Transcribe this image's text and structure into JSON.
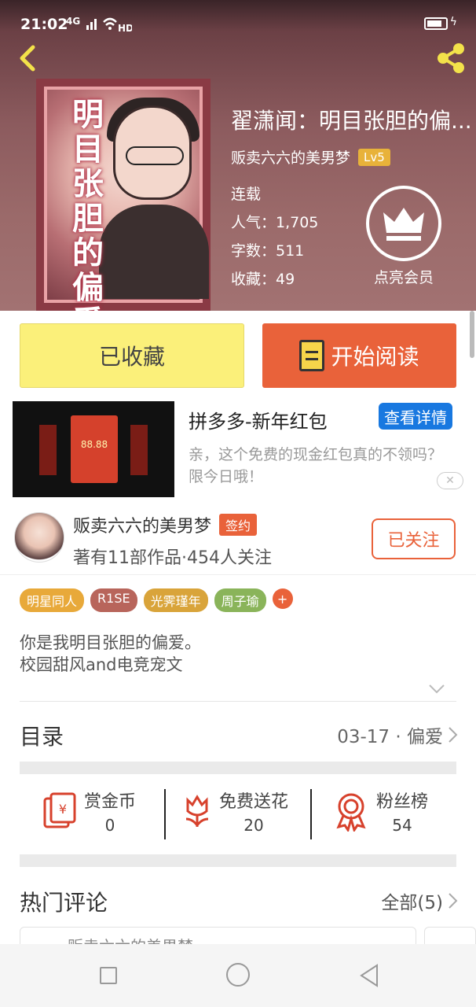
{
  "status_bar": {
    "time": "21:02",
    "network": "4G"
  },
  "book": {
    "title": "翟潇闻：明目张胆的偏...",
    "cover_text": "明目张胆的偏爱",
    "author": "贩卖六六的美男梦",
    "author_level": "Lv5",
    "status": "连载",
    "popularity": "人气：1,705",
    "word_count": "字数：511",
    "favorites": "收藏：49",
    "vip_label": "点亮会员"
  },
  "actions": {
    "collected_label": "已收藏",
    "read_label": "开始阅读"
  },
  "ad": {
    "title": "拼多多-新年红包",
    "button": "查看详情",
    "description": "亲，这个免费的现金红包真的不领吗？限今日哦！",
    "amount": "88.88"
  },
  "author_card": {
    "name": "贩卖六六的美男梦",
    "badge": "签约",
    "meta": "著有11部作品·454人关注",
    "follow_label": "已关注"
  },
  "tags": [
    {
      "label": "明星同人",
      "color": "#e8a93a"
    },
    {
      "label": "R1SE",
      "color": "#b8655b"
    },
    {
      "label": "光霁瑾年",
      "color": "#d9a43a"
    },
    {
      "label": "周子瑜",
      "color": "#8ab45a"
    }
  ],
  "tag_add": "+",
  "intro": {
    "line1": "你是我明目张胆的偏爱。",
    "line2": "校园甜风and电竞宠文"
  },
  "toc": {
    "title": "目录",
    "latest": "03-17 · 偏爱"
  },
  "stats": {
    "reward": {
      "label": "赏金币",
      "value": "0"
    },
    "flowers": {
      "label": "免费送花",
      "value": "20"
    },
    "fans": {
      "label": "粉丝榜",
      "value": "54"
    }
  },
  "comments": {
    "title": "热门评论",
    "all": "全部(5)",
    "peek": "贩卖六六的美男梦"
  },
  "colors": {
    "accent": "#e9623a",
    "collected_bg": "#fbf07a",
    "ad_button": "#1878e0"
  }
}
